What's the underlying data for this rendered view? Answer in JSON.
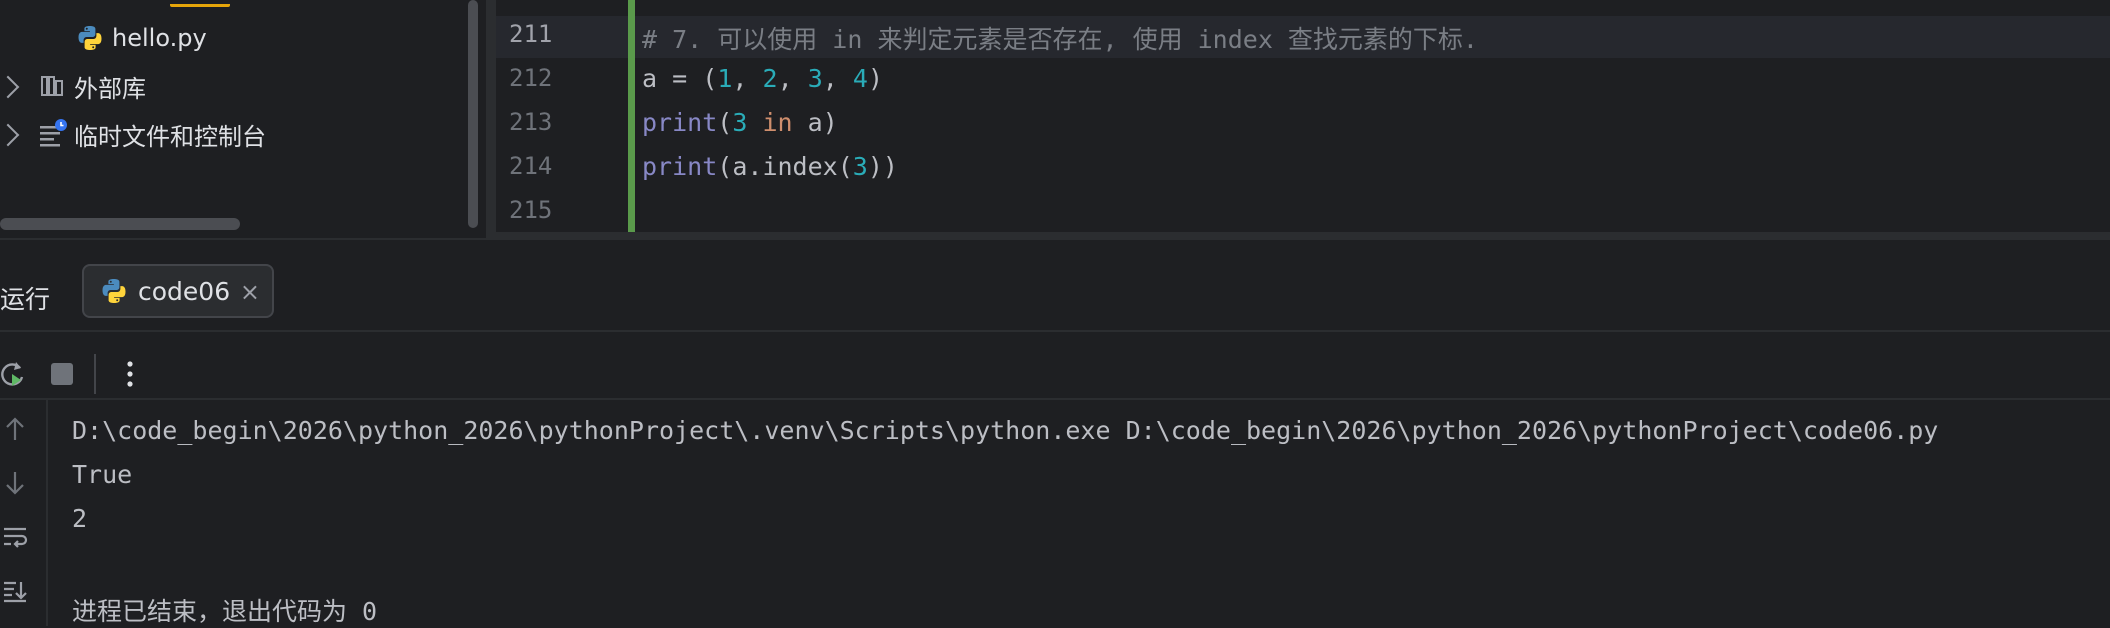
{
  "project_tree": {
    "items": [
      {
        "label": "hello.py",
        "icon": "python-file-icon"
      },
      {
        "label": "外部库",
        "icon": "library-icon"
      },
      {
        "label": "临时文件和控制台",
        "icon": "scratches-icon"
      }
    ]
  },
  "editor": {
    "lines": [
      {
        "number": "211",
        "text": "# 7. 可以使用 in 来判定元素是否存在, 使用 index 查找元素的下标."
      },
      {
        "number": "212",
        "text": "a = (1, 2, 3, 4)"
      },
      {
        "number": "213",
        "text": "print(3 in a)"
      },
      {
        "number": "214",
        "text": "print(a.index(3))"
      },
      {
        "number": "215",
        "text": ""
      }
    ]
  },
  "run_window": {
    "title": "运行",
    "tab_label": "code06",
    "close_glyph": "×",
    "toolbar": {
      "rerun_icon": "rerun-icon",
      "stop_icon": "stop-icon",
      "more_icon": "more-vertical-icon"
    },
    "console": {
      "lines": [
        "D:\\code_begin\\2026\\python_2026\\pythonProject\\.venv\\Scripts\\python.exe D:\\code_begin\\2026\\python_2026\\pythonProject\\code06.py",
        "True",
        "2",
        "",
        "进程已结束，退出代码为 0"
      ]
    }
  },
  "colors": {
    "background": "#1e1f22",
    "panel": "#2b2d30",
    "comment": "#7a7e85",
    "number": "#2aacb8",
    "keyword": "#cf8e6d",
    "builtin": "#8888c6",
    "change_bar": "#5a9a4b"
  }
}
